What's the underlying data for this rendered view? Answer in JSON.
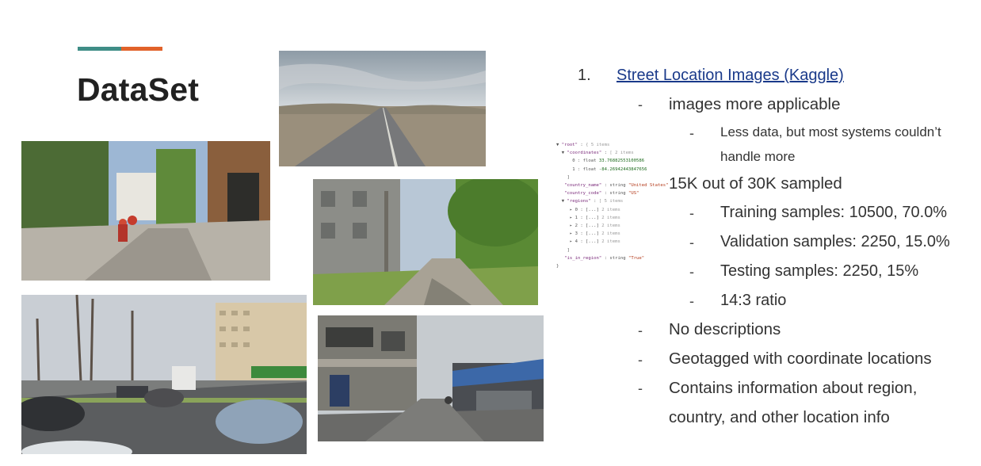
{
  "slide": {
    "title": "DataSet",
    "accent_colors": [
      "#3f8d86",
      "#e1622a"
    ]
  },
  "photos": [
    {
      "name": "steppe-road",
      "alt": "empty road through dry grassland"
    },
    {
      "name": "plaza-street",
      "alt": "pedestrians on a sunny street"
    },
    {
      "name": "village-road",
      "alt": "village road with building and trees"
    },
    {
      "name": "city-avenue",
      "alt": "avenue with cars and apartment blocks"
    },
    {
      "name": "market-street",
      "alt": "street with shops and vendors"
    }
  ],
  "json_snippet": {
    "root": "\"root\"",
    "root_meta": "{ 5 items",
    "coordinates": "\"coordinates\"",
    "coord_meta": "[ 2 items",
    "coord0_val": "33.76882553100586",
    "coord1_val": "-84.26942443847656",
    "country_name_key": "\"country_name\"",
    "country_name_val": "\"United States\"",
    "country_code_key": "\"country_code\"",
    "country_code_val": "\"US\"",
    "regions_key": "\"regions\"",
    "regions_meta": "[ 5 items",
    "region_items": [
      "0",
      "1",
      "2",
      "3",
      "4"
    ],
    "region_item_meta": "2 items",
    "is_in_region_key": "\"is_in_region\"",
    "is_in_region_val": "\"True\""
  },
  "list": {
    "item1_number": "1.",
    "item1_link": "Street Location Images (Kaggle)",
    "dash": "-",
    "sub_applicable": "images more applicable",
    "sub_less_data_1": "Less data, but most systems couldn’t",
    "sub_less_data_2": "handle more",
    "sampled": "15K out of 30K sampled",
    "training": "Training samples: 10500, 70.0%",
    "validation": "Validation samples: 2250, 15.0%",
    "testing": "Testing samples: 2250, 15%",
    "ratio": "14:3 ratio",
    "no_desc": "No descriptions",
    "geotagged": "Geotagged with coordinate locations",
    "contains_1": "Contains information about region,",
    "contains_2": "country, and other location info"
  }
}
